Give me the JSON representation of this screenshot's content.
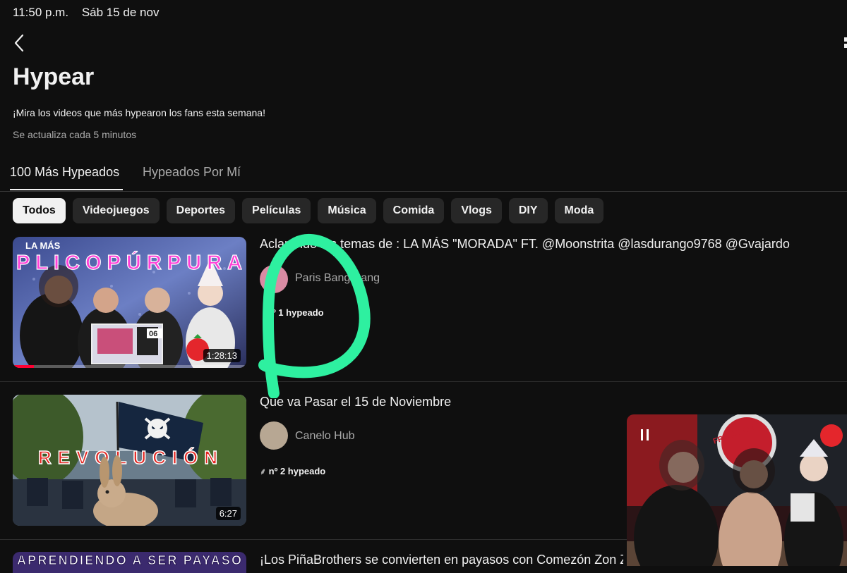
{
  "status_bar": {
    "time": "11:50 p.m.",
    "date": "Sáb 15 de nov"
  },
  "page": {
    "title": "Hypear",
    "subtitle": "¡Mira los videos que más hypearon los fans esta semana!",
    "update_note": "Se actualiza cada 5 minutos"
  },
  "tabs": [
    {
      "label": "100 Más Hypeados",
      "active": true
    },
    {
      "label": "Hypeados Por Mí",
      "active": false
    }
  ],
  "chips": [
    {
      "label": "Todos",
      "active": true
    },
    {
      "label": "Videojuegos"
    },
    {
      "label": "Deportes"
    },
    {
      "label": "Películas"
    },
    {
      "label": "Música"
    },
    {
      "label": "Comida"
    },
    {
      "label": "Vlogs"
    },
    {
      "label": "DIY"
    },
    {
      "label": "Moda"
    }
  ],
  "videos": [
    {
      "title": "Aclarando los temas de : LA MÁS \"MORADA\" FT. @Moonstrita @lasdurango9768 @Gvajardo",
      "channel": "Paris Bang Bang",
      "rank": "nº 1 hypeado",
      "duration": "1:28:13",
      "thumb_banner_top": "LA MÁS",
      "thumb_banner": "PLICOPÚRPURA",
      "thumb_counter": "06",
      "progress": 0.09
    },
    {
      "title": "Que va Pasar el 15 de Noviembre",
      "channel": "Canelo Hub",
      "rank": "nº 2 hypeado",
      "duration": "6:27",
      "thumb_banner": "REVOLUCIÓN"
    },
    {
      "title": "¡Los PiñaBrothers se convierten en payasos con Comezón Zon Z",
      "thumb_banner": "APRENDIENDO A SER PAYASO"
    }
  ],
  "mini_player": {
    "sign_text": "FRESUKON"
  },
  "colors": {
    "background": "#0f0f0f",
    "chip": "#272727",
    "chip_active": "#f1f1f1",
    "secondary_text": "#aaaaaa",
    "progress_red": "#ff0033",
    "annotation_green": "#2ef0a0"
  }
}
